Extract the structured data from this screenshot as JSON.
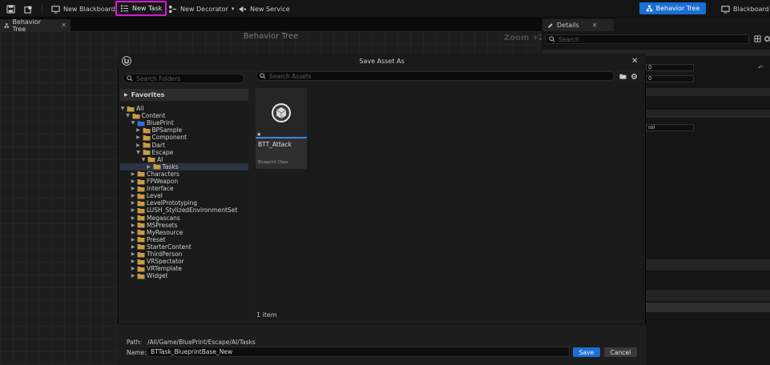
{
  "toolbar": {
    "new_blackboard": "New Blackboard",
    "new_task": "New Task",
    "new_decorator": "New Decorator",
    "new_service": "New Service",
    "behavior_tree_mode": "Behavior Tree",
    "blackboard_mode": "Blackboard",
    "accent_color": "#1a6fd4",
    "highlight_color": "#d21bd2"
  },
  "tabs": {
    "editor_tab": "Behavior Tree",
    "details_tab": "Details"
  },
  "graph": {
    "title": "Behavior Tree",
    "zoom": "Zoom +2"
  },
  "details": {
    "search_placeholder": "Search",
    "field_a": "0",
    "field_b": "0",
    "field_c": "ıal"
  },
  "dialog": {
    "title": "Save Asset As",
    "folder_search_placeholder": "Search Folders",
    "asset_search_placeholder": "Search Assets",
    "favorites": "Favorites",
    "tree": [
      {
        "label": "All",
        "depth": 0,
        "expanded": true,
        "selected": false
      },
      {
        "label": "Content",
        "depth": 1,
        "expanded": true,
        "selected": false
      },
      {
        "label": "BluePrint",
        "depth": 2,
        "expanded": true,
        "selected": false
      },
      {
        "label": "BPSample",
        "depth": 3,
        "expanded": false,
        "selected": false
      },
      {
        "label": "Component",
        "depth": 3,
        "expanded": false,
        "selected": false
      },
      {
        "label": "Dart",
        "depth": 3,
        "expanded": false,
        "selected": false
      },
      {
        "label": "Escape",
        "depth": 3,
        "expanded": true,
        "selected": false
      },
      {
        "label": "AI",
        "depth": 4,
        "expanded": true,
        "selected": false
      },
      {
        "label": "Tasks",
        "depth": 5,
        "expanded": false,
        "selected": true
      },
      {
        "label": "Characters",
        "depth": 2,
        "expanded": false,
        "selected": false
      },
      {
        "label": "FPWeapon",
        "depth": 2,
        "expanded": false,
        "selected": false
      },
      {
        "label": "Interface",
        "depth": 2,
        "expanded": false,
        "selected": false
      },
      {
        "label": "Level",
        "depth": 2,
        "expanded": false,
        "selected": false
      },
      {
        "label": "LevelPrototyping",
        "depth": 2,
        "expanded": false,
        "selected": false
      },
      {
        "label": "LUSH_StylizedEnvironmentSet",
        "depth": 2,
        "expanded": false,
        "selected": false
      },
      {
        "label": "Megascans",
        "depth": 2,
        "expanded": false,
        "selected": false
      },
      {
        "label": "MSPresets",
        "depth": 2,
        "expanded": false,
        "selected": false
      },
      {
        "label": "MyResource",
        "depth": 2,
        "expanded": false,
        "selected": false
      },
      {
        "label": "Preset",
        "depth": 2,
        "expanded": false,
        "selected": false
      },
      {
        "label": "StarterContent",
        "depth": 2,
        "expanded": false,
        "selected": false
      },
      {
        "label": "ThirdPerson",
        "depth": 2,
        "expanded": false,
        "selected": false
      },
      {
        "label": "VRSpectator",
        "depth": 2,
        "expanded": false,
        "selected": false
      },
      {
        "label": "VRTemplate",
        "depth": 2,
        "expanded": false,
        "selected": false
      },
      {
        "label": "Widget",
        "depth": 2,
        "expanded": false,
        "selected": false
      }
    ],
    "asset": {
      "name": "BTT_Attack",
      "class": "Blueprint Class"
    },
    "item_count": "1 item",
    "path_label": "Path:",
    "path_value": "/All/Game/BluePrint/Escape/AI/Tasks",
    "name_label": "Name:",
    "name_value": "BTTask_BlueprintBase_New",
    "save_label": "Save",
    "cancel_label": "Cancel"
  }
}
